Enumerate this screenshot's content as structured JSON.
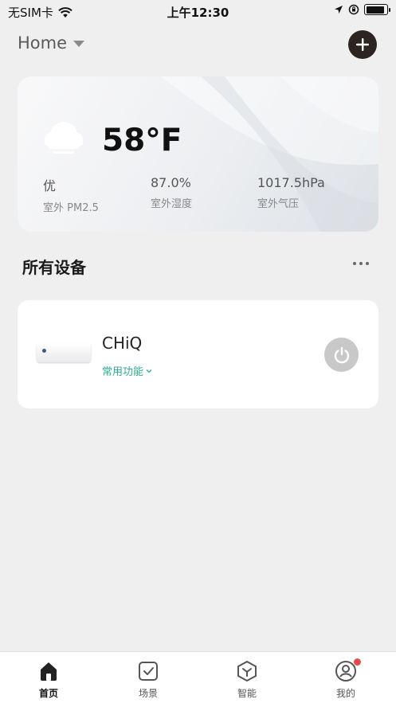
{
  "status_bar": {
    "carrier": "无SIM卡",
    "time": "上午12:30",
    "battery_level": 0.9
  },
  "header": {
    "home_label": "Home"
  },
  "weather": {
    "temperature": "58°F",
    "metrics": [
      {
        "value": "优",
        "label": "室外 PM2.5"
      },
      {
        "value": "87.0%",
        "label": "室外湿度"
      },
      {
        "value": "1017.5hPa",
        "label": "室外气压"
      }
    ]
  },
  "devices_section": {
    "title": "所有设备"
  },
  "device": {
    "name": "CHiQ",
    "functions_label": "常用功能"
  },
  "tabs": [
    {
      "label": "首页",
      "icon": "home-icon",
      "active": true
    },
    {
      "label": "场景",
      "icon": "scene-checkbox-icon",
      "active": false
    },
    {
      "label": "智能",
      "icon": "smart-hexagon-icon",
      "active": false
    },
    {
      "label": "我的",
      "icon": "profile-icon",
      "active": false,
      "badge": true
    }
  ],
  "colors": {
    "accent_green": "#2cae8f",
    "add_button": "#2b2420",
    "badge_red": "#e84a4a"
  }
}
